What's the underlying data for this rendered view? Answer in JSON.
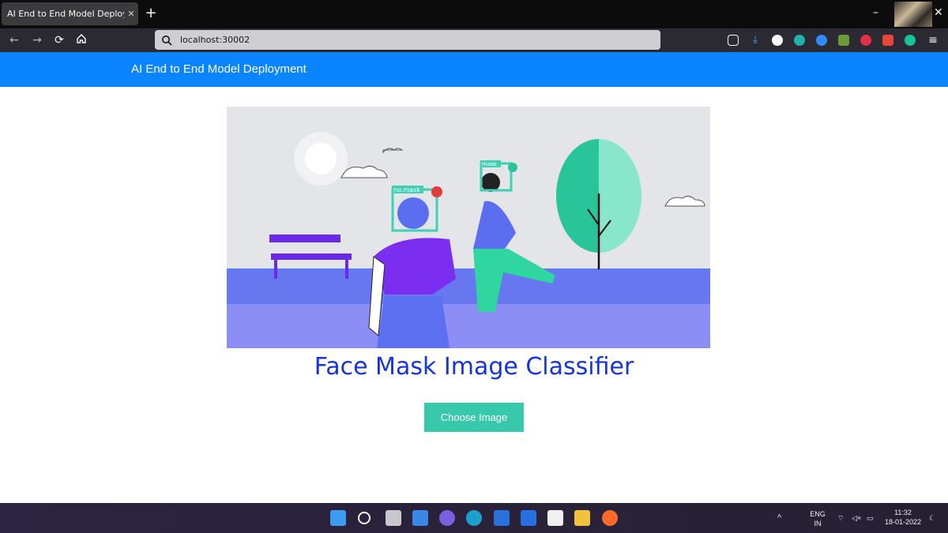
{
  "browser": {
    "tab_title": "AI End to End Model Deployment",
    "tab_close": "✕",
    "new_tab": "+",
    "url": "localhost:30002",
    "window_controls": {
      "minimize": "–",
      "close": "✕"
    }
  },
  "app": {
    "brand": "AI End to End Model Deployment",
    "title": "Face Mask Image Classifier",
    "choose_button": "Choose Image",
    "hero_labels": {
      "no_mask": "no.mask",
      "mask": "mask"
    }
  },
  "colors": {
    "header": "#0a84ff",
    "title": "#1535d8",
    "button": "#38c8ab"
  },
  "taskbar": {
    "lang_top": "ENG",
    "lang_bottom": "IN",
    "time": "11:32",
    "date": "18-01-2022"
  }
}
